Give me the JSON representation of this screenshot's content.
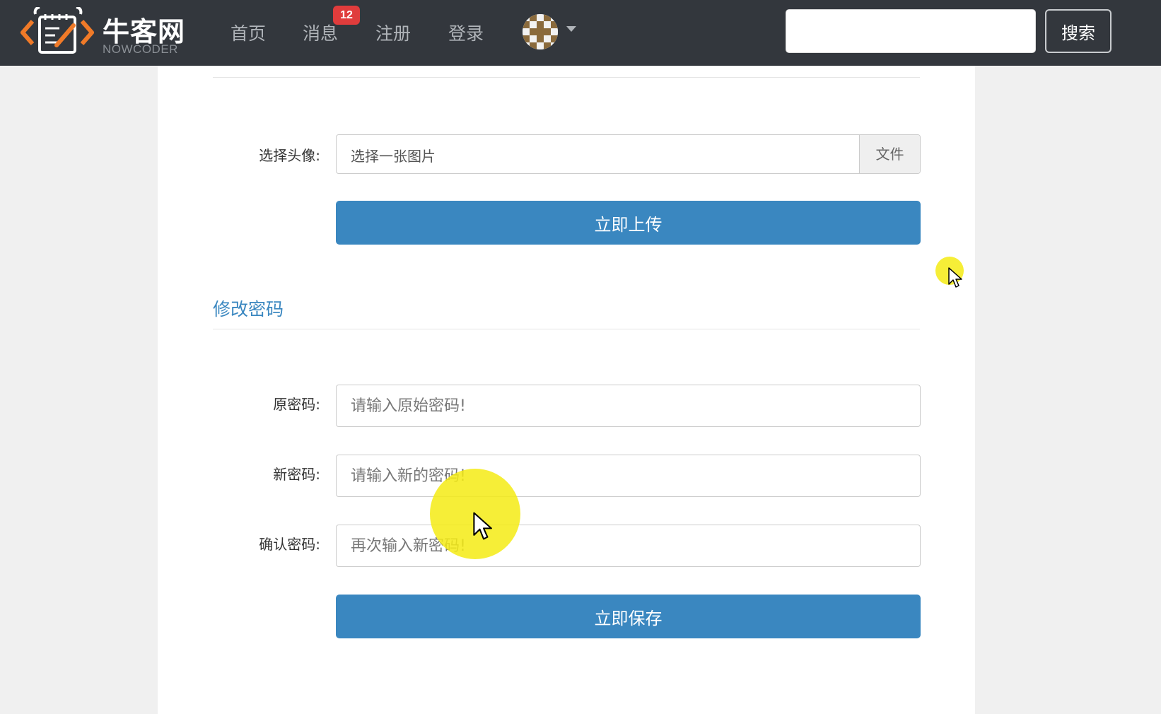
{
  "brand": {
    "name": "牛客网",
    "sub": "NOWCODER",
    "colors": {
      "orange": "#f07a28",
      "white": "#ffffff"
    }
  },
  "nav": {
    "items": [
      {
        "label": "首页"
      },
      {
        "label": "消息",
        "badge": "12"
      },
      {
        "label": "注册"
      },
      {
        "label": "登录"
      }
    ],
    "search_value": "",
    "search_button": "搜索"
  },
  "avatar_section": {
    "label": "选择头像:",
    "file_placeholder": "选择一张图片",
    "file_button": "文件",
    "upload_button": "立即上传"
  },
  "password_section": {
    "title": "修改密码",
    "fields": [
      {
        "label": "原密码:",
        "placeholder": "请输入原始密码!"
      },
      {
        "label": "新密码:",
        "placeholder": "请输入新的密码!"
      },
      {
        "label": "确认密码:",
        "placeholder": "再次输入新密码!"
      }
    ],
    "save_button": "立即保存"
  },
  "colors": {
    "navbar_bg": "#33373d",
    "primary": "#3a87c0",
    "badge": "#e03c3c",
    "cursor_highlight": "#f5eb14"
  }
}
